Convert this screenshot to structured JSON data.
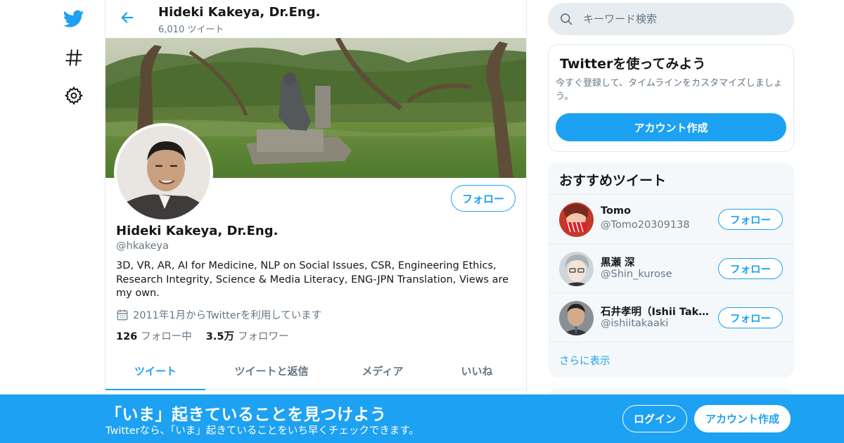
{
  "colors": {
    "accent": "#1da1f2",
    "text": "#14171a",
    "muted": "#657786",
    "border": "#e6ecf0"
  },
  "nav": {
    "icons": [
      "twitter-bird-icon",
      "hashtag-icon",
      "settings-gear-icon"
    ]
  },
  "header": {
    "name": "Hideki Kakeya, Dr.Eng.",
    "tweet_count": "6,010 ツイート"
  },
  "profile": {
    "name": "Hideki Kakeya, Dr.Eng.",
    "handle": "@hkakeya",
    "bio": "3D, VR, AR, AI for Medicine, NLP on Social Issues, CSR, Engineering Ethics, Research Integrity, Science & Media Literacy, ENG-JPN Translation, Views are my own.",
    "joined": "2011年1月からTwitterを利用しています",
    "following_count": "126",
    "following_label": "フォロー中",
    "followers_count": "3.5万",
    "followers_label": "フォロワー",
    "follow_button": "フォロー"
  },
  "tabs": [
    {
      "label": "ツイート",
      "active": true
    },
    {
      "label": "ツイートと返信",
      "active": false
    },
    {
      "label": "メディア",
      "active": false
    },
    {
      "label": "いいね",
      "active": false
    }
  ],
  "search": {
    "placeholder": "キーワード検索"
  },
  "signup_card": {
    "title": "Twitterを使ってみよう",
    "description": "今すぐ登録して、タイムラインをカスタマイズしましょう。",
    "button": "アカウント作成"
  },
  "who_to_follow": {
    "title": "おすすめツイート",
    "users": [
      {
        "name": "Tomo",
        "handle": "@Tomo20309138",
        "button": "フォロー"
      },
      {
        "name": "黒瀬 深",
        "handle": "@Shin_kurose",
        "button": "フォロー"
      },
      {
        "name": "石井孝明（Ishii Takaaki）",
        "handle": "@ishiitakaaki",
        "button": "フォロー"
      }
    ],
    "show_more": "さらに表示"
  },
  "bottom_bar": {
    "title": "「いま」起きていることを見つけよう",
    "subtitle": "Twitterなら、「いま」起きていることをいち早くチェックできます。",
    "login": "ログイン",
    "signup": "アカウント作成"
  }
}
